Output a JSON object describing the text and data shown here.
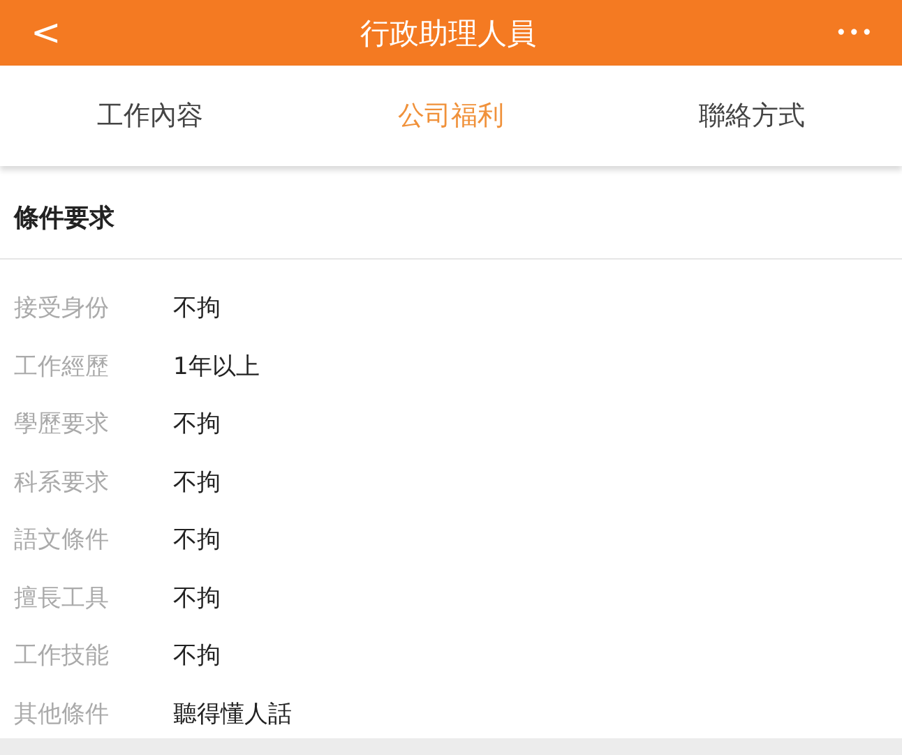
{
  "header": {
    "back": "<",
    "title": "行政助理人員",
    "more": "•••"
  },
  "tabs": [
    {
      "label": "工作內容",
      "selected": false
    },
    {
      "label": "公司福利",
      "selected": true
    },
    {
      "label": "聯絡方式",
      "selected": false
    }
  ],
  "section": {
    "title": "條件要求"
  },
  "rows": [
    {
      "label": "接受身份",
      "value": "不拘"
    },
    {
      "label": "工作經歷",
      "value": "1年以上"
    },
    {
      "label": "學歷要求",
      "value": "不拘"
    },
    {
      "label": "科系要求",
      "value": "不拘"
    },
    {
      "label": "語文條件",
      "value": "不拘"
    },
    {
      "label": "擅長工具",
      "value": "不拘"
    },
    {
      "label": "工作技能",
      "value": "不拘"
    },
    {
      "label": "其他條件",
      "value": "聽得懂人話"
    }
  ]
}
